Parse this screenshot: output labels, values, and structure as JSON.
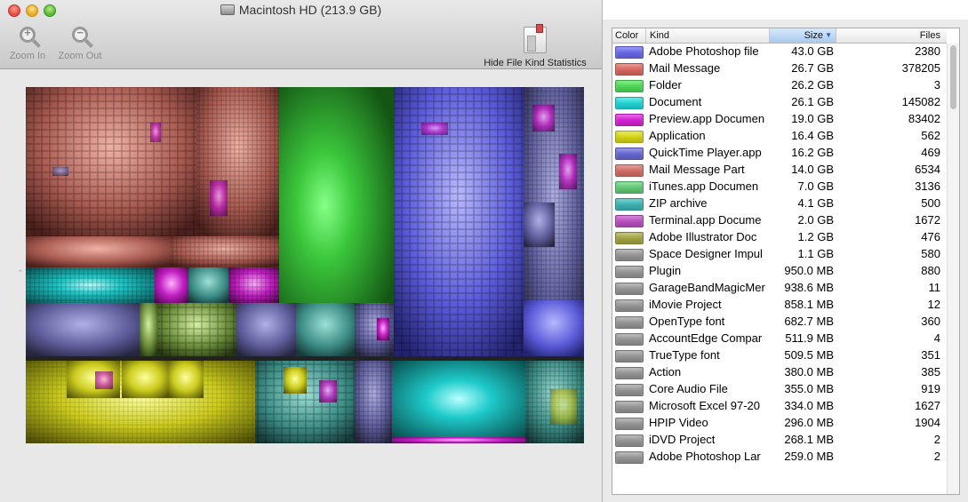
{
  "window": {
    "title": "Macintosh HD (213.9 GB)",
    "toolbar": {
      "zoom_in_label": "Zoom In",
      "zoom_out_label": "Zoom Out",
      "hide_stats_label": "Hide File Kind Statistics"
    }
  },
  "stats": {
    "columns": {
      "color": "Color",
      "kind": "Kind",
      "size": "Size",
      "files": "Files"
    },
    "sorted_by": "Size",
    "rows": [
      {
        "kind": "Adobe Photoshop file",
        "size": "43.0 GB",
        "files": "2380",
        "color": "#6b6bf0"
      },
      {
        "kind": "Mail Message",
        "size": "26.7 GB",
        "files": "378205",
        "color": "#e06a63"
      },
      {
        "kind": "Folder",
        "size": "26.2 GB",
        "files": "3",
        "color": "#4fe05a"
      },
      {
        "kind": "Document",
        "size": "26.1 GB",
        "files": "145082",
        "color": "#22dcdc"
      },
      {
        "kind": "Preview.app Documen",
        "size": "19.0 GB",
        "files": "83402",
        "color": "#dc22dc"
      },
      {
        "kind": "Application",
        "size": "16.4 GB",
        "files": "562",
        "color": "#dcdc16"
      },
      {
        "kind": "QuickTime Player.app",
        "size": "16.2 GB",
        "files": "469",
        "color": "#6a6ad8"
      },
      {
        "kind": "Mail Message Part",
        "size": "14.0 GB",
        "files": "6534",
        "color": "#d9706a"
      },
      {
        "kind": "iTunes.app Documen",
        "size": "7.0 GB",
        "files": "3136",
        "color": "#62d17a"
      },
      {
        "kind": "ZIP archive",
        "size": "4.1 GB",
        "files": "500",
        "color": "#3fb8b8"
      },
      {
        "kind": "Terminal.app Docume",
        "size": "2.0 GB",
        "files": "1672",
        "color": "#c050c8"
      },
      {
        "kind": "Adobe Illustrator Doc",
        "size": "1.2 GB",
        "files": "476",
        "color": "#a9a945"
      },
      {
        "kind": "Space Designer Impul",
        "size": "1.1 GB",
        "files": "580",
        "color": "#9a9a9a"
      },
      {
        "kind": "Plugin",
        "size": "950.0 MB",
        "files": "880",
        "color": "#9a9a9a"
      },
      {
        "kind": "GarageBandMagicMer",
        "size": "938.6 MB",
        "files": "11",
        "color": "#9a9a9a"
      },
      {
        "kind": "iMovie Project",
        "size": "858.1 MB",
        "files": "12",
        "color": "#9a9a9a"
      },
      {
        "kind": "OpenType font",
        "size": "682.7 MB",
        "files": "360",
        "color": "#9a9a9a"
      },
      {
        "kind": "AccountEdge Compar",
        "size": "511.9 MB",
        "files": "4",
        "color": "#9a9a9a"
      },
      {
        "kind": "TrueType font",
        "size": "509.5 MB",
        "files": "351",
        "color": "#9a9a9a"
      },
      {
        "kind": "Action",
        "size": "380.0 MB",
        "files": "385",
        "color": "#9a9a9a"
      },
      {
        "kind": "Core Audio File",
        "size": "355.0 MB",
        "files": "919",
        "color": "#9a9a9a"
      },
      {
        "kind": "Microsoft Excel 97-20",
        "size": "334.0 MB",
        "files": "1627",
        "color": "#9a9a9a"
      },
      {
        "kind": "HPIP Video",
        "size": "296.0 MB",
        "files": "1904",
        "color": "#9a9a9a"
      },
      {
        "kind": "iDVD Project",
        "size": "268.1 MB",
        "files": "2",
        "color": "#9a9a9a"
      },
      {
        "kind": "Adobe Photoshop Lar",
        "size": "259.0 MB",
        "files": "2",
        "color": "#9a9a9a"
      }
    ]
  }
}
